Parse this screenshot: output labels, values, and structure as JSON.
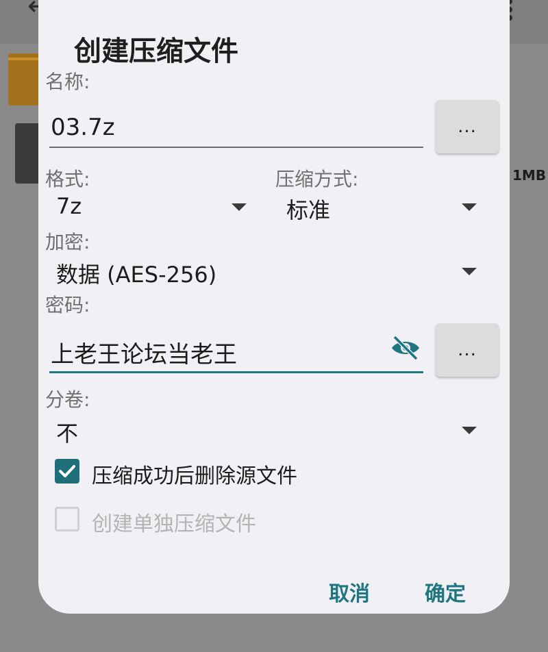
{
  "dialog": {
    "title": "创建压缩文件",
    "name_label": "名称:",
    "name_value": "03.7z",
    "more_button": "...",
    "format_label": "格式:",
    "format_value": "7z",
    "compression_label": "压缩方式:",
    "compression_value": "标准",
    "encryption_label": "加密:",
    "encryption_value": "数据 (AES-256)",
    "password_label": "密码:",
    "password_value": "上老王论坛当老王",
    "volume_label": "分卷:",
    "volume_value": "不",
    "delete_source_label": "压缩成功后删除源文件",
    "delete_source_checked": true,
    "separate_archives_label": "创建单独压缩文件",
    "separate_archives_checked": false,
    "cancel_label": "取消",
    "ok_label": "确定"
  },
  "background": {
    "file_size": "1MB"
  },
  "colors": {
    "accent": "#1e7681",
    "dialog_bg": "#f1f0f5"
  }
}
